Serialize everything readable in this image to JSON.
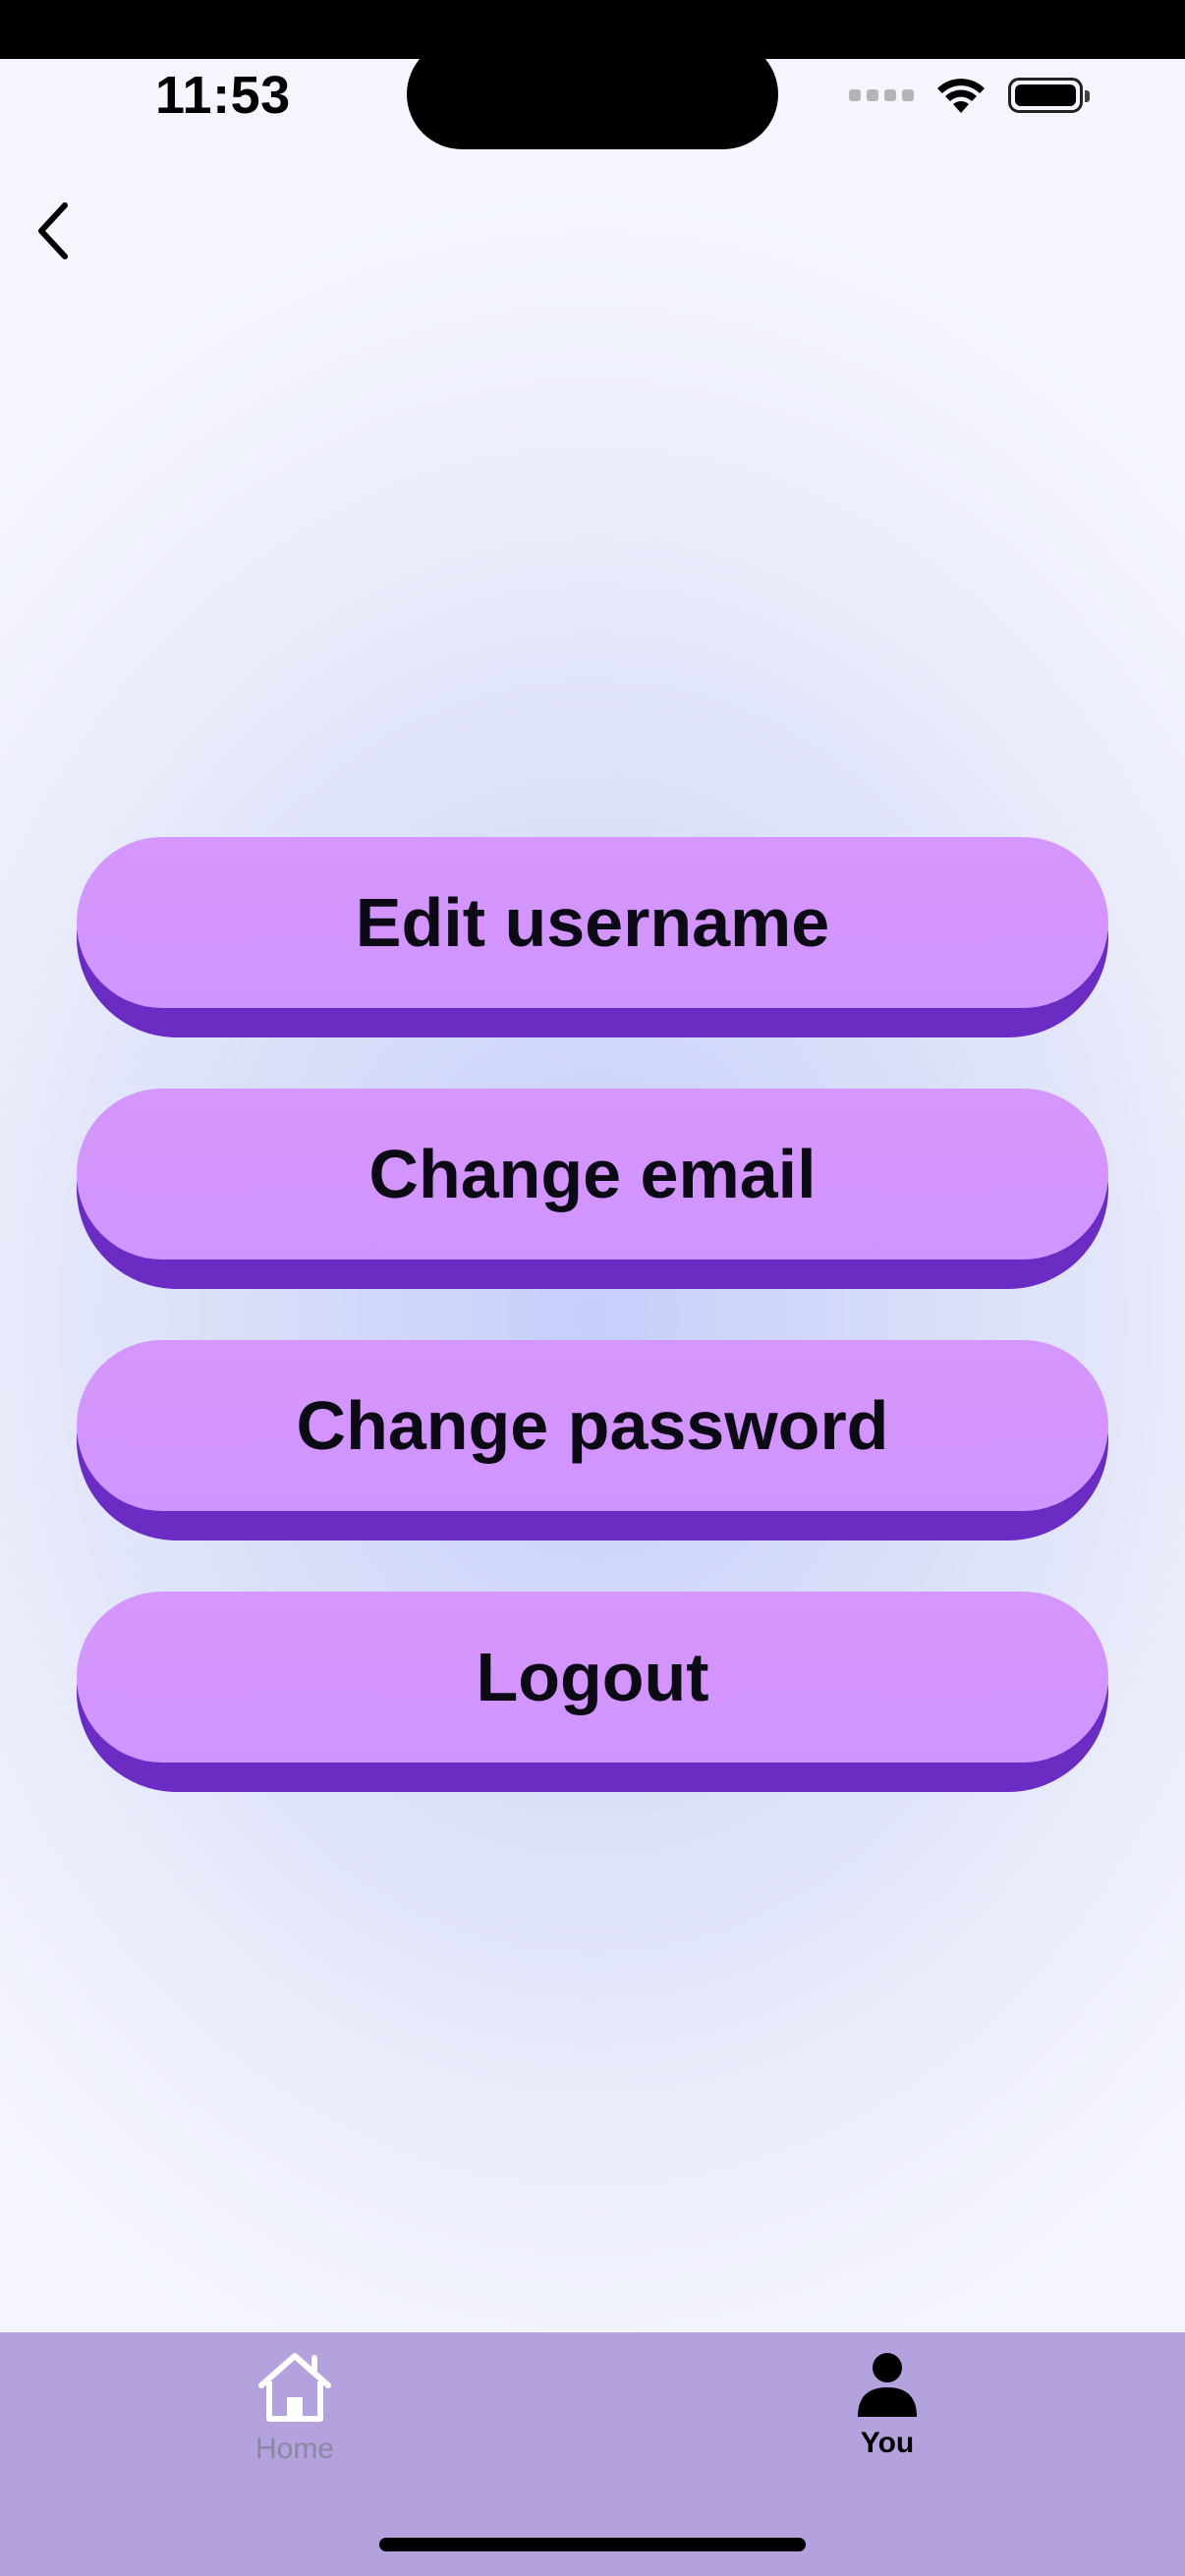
{
  "status_bar": {
    "time": "11:53",
    "icons": [
      "cellular-signal-icon",
      "wifi-icon",
      "battery-icon"
    ]
  },
  "navigation": {
    "back_icon": "chevron-left-icon"
  },
  "actions": [
    {
      "label": "Edit username"
    },
    {
      "label": "Change email"
    },
    {
      "label": "Change password"
    },
    {
      "label": "Logout"
    }
  ],
  "tab_bar": {
    "items": [
      {
        "label": "Home",
        "icon": "home-icon",
        "selected": false
      },
      {
        "label": "You",
        "icon": "person-icon",
        "selected": true
      }
    ]
  },
  "colors": {
    "button_face": "#d395fd",
    "button_shadow": "#6a2cc3",
    "tab_bar_bg": "#b3a2de",
    "tab_inactive": "#8d86a3",
    "tab_active": "#000000"
  }
}
